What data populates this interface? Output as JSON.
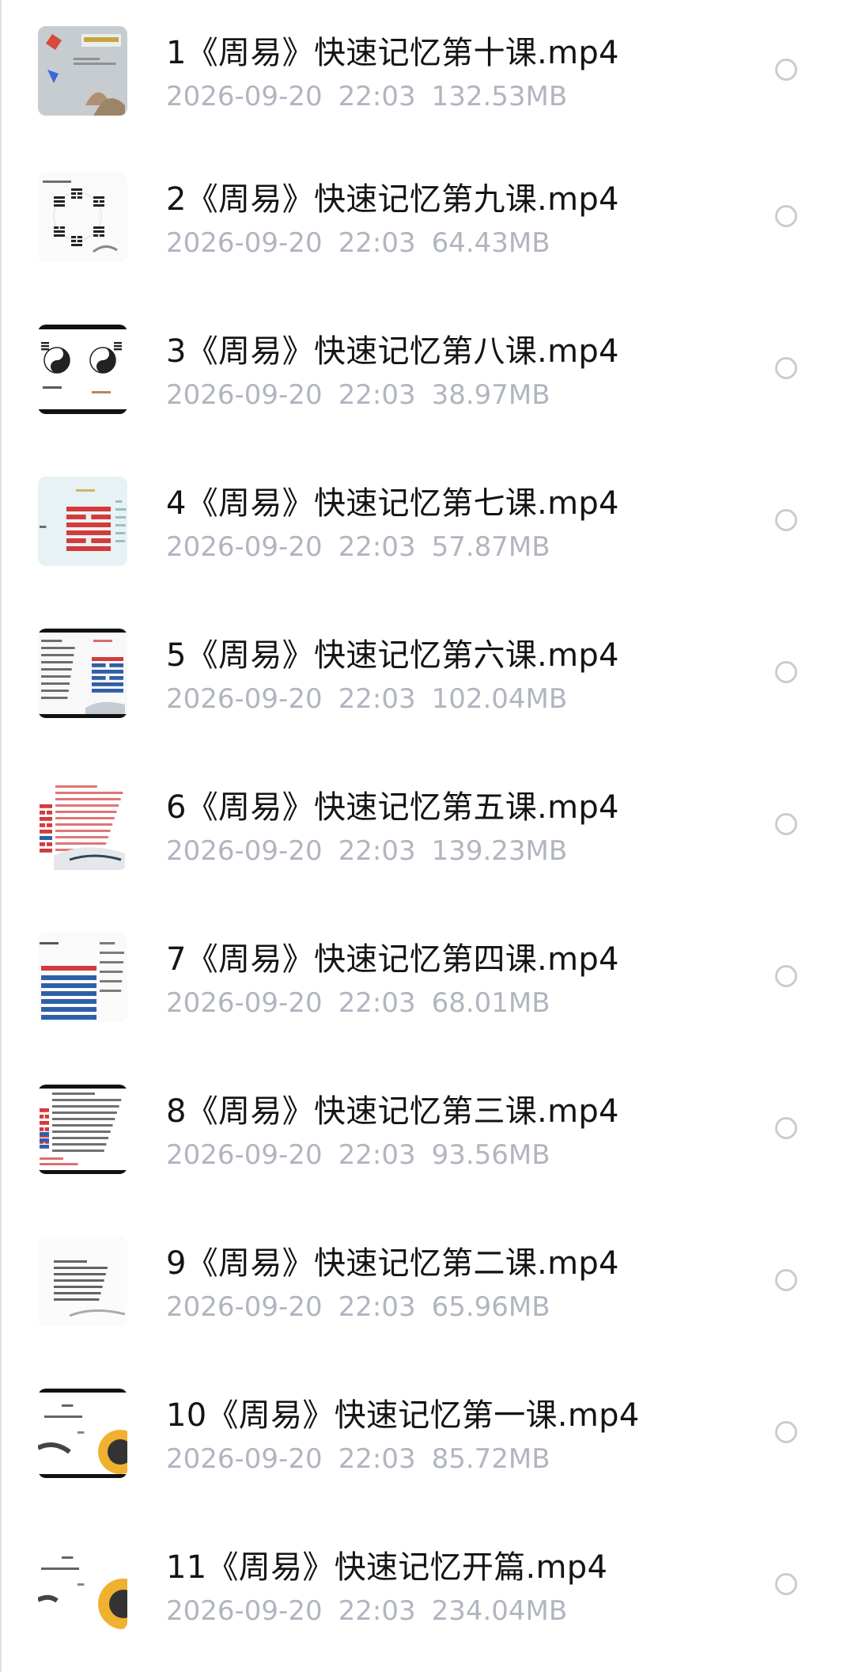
{
  "files": [
    {
      "name": "1《周易》快速记忆第十课.mp4",
      "date": "2026-09-20",
      "time": "22:03",
      "size": "132.53MB",
      "thumb_style": "kites"
    },
    {
      "name": "2《周易》快速记忆第九课.mp4",
      "date": "2026-09-20",
      "time": "22:03",
      "size": "64.43MB",
      "thumb_style": "bagua-circle"
    },
    {
      "name": "3《周易》快速记忆第八课.mp4",
      "date": "2026-09-20",
      "time": "22:03",
      "size": "38.97MB",
      "thumb_style": "yin-yang-dark"
    },
    {
      "name": "4《周易》快速记忆第七课.mp4",
      "date": "2026-09-20",
      "time": "22:03",
      "size": "57.87MB",
      "thumb_style": "red-hexagram"
    },
    {
      "name": "5《周易》快速记忆第六课.mp4",
      "date": "2026-09-20",
      "time": "22:03",
      "size": "102.04MB",
      "thumb_style": "blue-red-hexagram"
    },
    {
      "name": "6《周易》快速记忆第五课.mp4",
      "date": "2026-09-20",
      "time": "22:03",
      "size": "139.23MB",
      "thumb_style": "red-text"
    },
    {
      "name": "7《周易》快速记忆第四课.mp4",
      "date": "2026-09-20",
      "time": "22:03",
      "size": "68.01MB",
      "thumb_style": "blue-hexagram"
    },
    {
      "name": "8《周易》快速记忆第三课.mp4",
      "date": "2026-09-20",
      "time": "22:03",
      "size": "93.56MB",
      "thumb_style": "text-dark"
    },
    {
      "name": "9《周易》快速记忆第二课.mp4",
      "date": "2026-09-20",
      "time": "22:03",
      "size": "65.96MB",
      "thumb_style": "text-light"
    },
    {
      "name": "10《周易》快速记忆第一课.mp4",
      "date": "2026-09-20",
      "time": "22:03",
      "size": "85.72MB",
      "thumb_style": "intro-yinyang"
    },
    {
      "name": "11《周易》快速记忆开篇.mp4",
      "date": "2026-09-20",
      "time": "22:03",
      "size": "234.04MB",
      "thumb_style": "intro-yinyang-light"
    }
  ],
  "colors": {
    "title": "#141414",
    "meta": "#b1b5bf",
    "radio_border": "#c9ccd2"
  },
  "icons": {
    "select": "radio-circle-icon",
    "thumbnail": "video-thumbnail"
  }
}
